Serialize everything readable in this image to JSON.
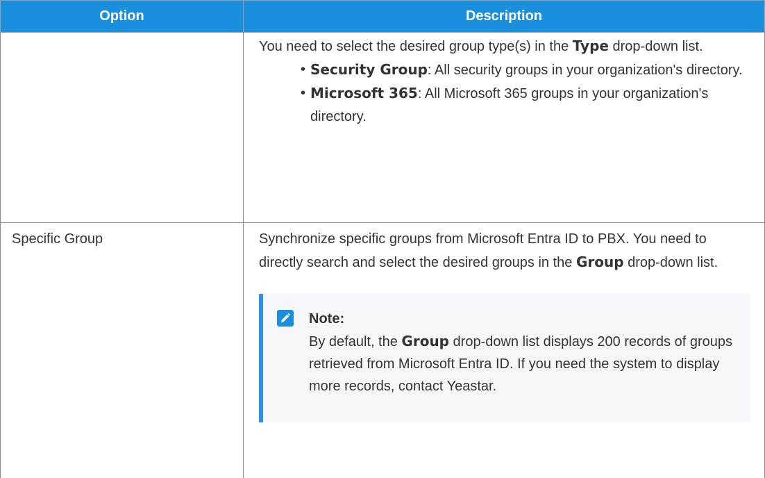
{
  "table": {
    "headers": {
      "option": "Option",
      "description": "Description"
    },
    "row1": {
      "option": "",
      "desc_part1": "You need to select the desired group type(s) in the ",
      "desc_bold": "Type",
      "desc_part2": " drop-down list.",
      "bullets": [
        {
          "term": "Security Group",
          "text": ": All security groups in your organization's directory."
        },
        {
          "term": "Microsoft 365",
          "text": ": All Microsoft 365 groups in your organization's directory."
        }
      ]
    },
    "row2": {
      "option": "Specific Group",
      "desc_line1": "Synchronize specific groups from Microsoft Entra ID to PBX. You need to directly search and select the desired groups in the ",
      "desc_bold": "Group",
      "desc_line2": " drop-down list.",
      "note": {
        "title": "Note:",
        "text_part1": "By default, the ",
        "text_bold": "Group",
        "text_part2": " drop-down list displays 200 records of groups retrieved from Microsoft Entra ID. If you need the system to display more records, contact Yeastar.",
        "icon": "pencil-note-icon"
      }
    }
  },
  "colors": {
    "header_bg": "#1a8fdd",
    "header_text": "#ffffff",
    "note_bar": "#2d8cf0",
    "note_bg": "#f5f7fa",
    "body_text": "#333333"
  }
}
